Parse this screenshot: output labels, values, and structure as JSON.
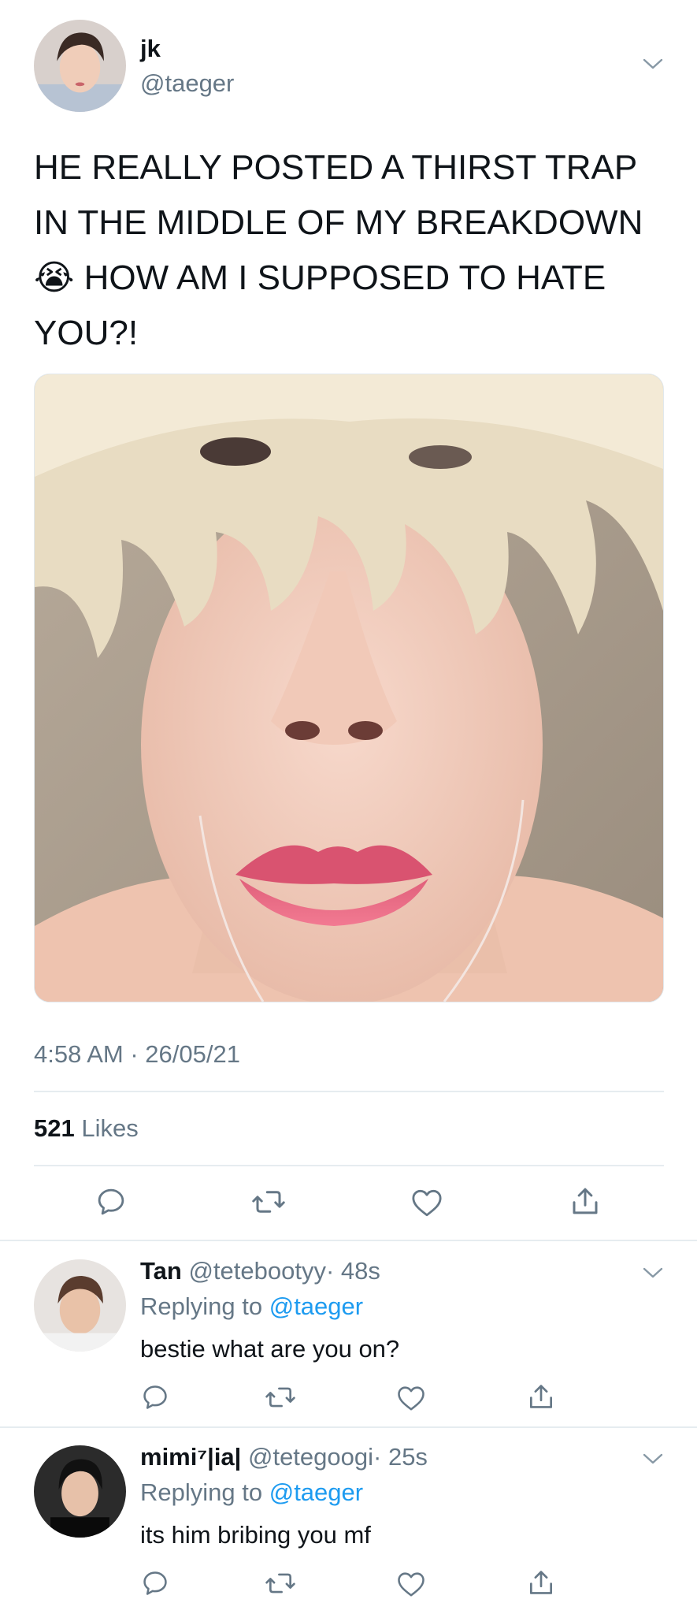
{
  "tweet": {
    "author_name": "jk",
    "author_handle": "@taeger",
    "text_line1": "HE REALLY POSTED A THIRST TRAP",
    "text_line2": "IN THE MIDDLE OF MY BREAKDOWN",
    "text_line3_emoji": "😭",
    "text_line3": "HOW AM I SUPPOSED TO HATE",
    "text_line4": "YOU?!",
    "timestamp": "4:58 AM · 26/05/21",
    "likes_count": "521",
    "likes_label": "Likes"
  },
  "replies": [
    {
      "name": "Tan",
      "handle": "@tetebootyy",
      "time": "· 48s",
      "replying_label": "Replying to",
      "replying_to": "@taeger",
      "text": "bestie what are you on?"
    },
    {
      "name": "mimi⁷|ia|",
      "handle": "@tetegoogi",
      "time": "· 25s",
      "replying_label": "Replying to",
      "replying_to": "@taeger",
      "text": "its him bribing you mf"
    }
  ],
  "icons": {
    "menu": "chevron-down-icon",
    "reply": "reply-icon",
    "retweet": "retweet-icon",
    "like": "heart-icon",
    "share": "share-icon"
  },
  "colors": {
    "text": "#0f1419",
    "secondary": "#657786",
    "link": "#1d9bf0",
    "divider": "#e6ecf0"
  }
}
